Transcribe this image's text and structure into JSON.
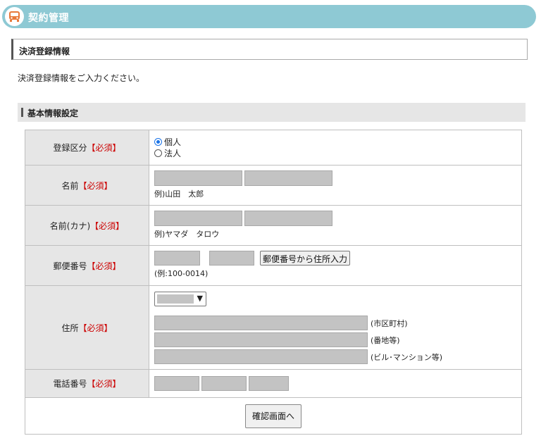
{
  "header": {
    "title": "契約管理",
    "icon": "bus-icon",
    "color": "#8ec9d4"
  },
  "section": {
    "title": "決済登録情報"
  },
  "intro": "決済登録情報をご入力ください。",
  "subsection": {
    "title": "基本情報設定"
  },
  "required_mark": "【必須】",
  "fields": {
    "category": {
      "label": "登録区分",
      "options": [
        "個人",
        "法人"
      ],
      "selected": "個人"
    },
    "name": {
      "label": "名前",
      "example": "例)山田　太郎"
    },
    "name_kana": {
      "label": "名前(カナ)",
      "example": "例)ヤマダ　タロウ"
    },
    "zip": {
      "label": "郵便番号",
      "button": "郵便番号から住所入力",
      "example": "(例:100-0014)"
    },
    "address": {
      "label": "住所",
      "suffix_city": "(市区町村)",
      "suffix_block": "(番地等)",
      "suffix_building": "(ビル･マンション等)"
    },
    "phone": {
      "label": "電話番号"
    }
  },
  "submit": {
    "label": "確認画面へ"
  }
}
